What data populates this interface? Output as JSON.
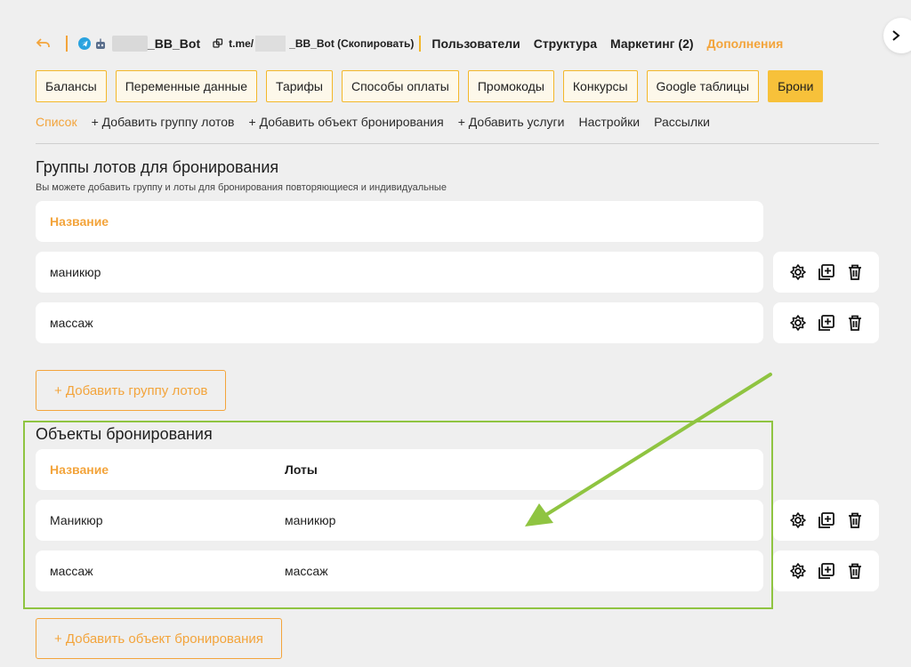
{
  "topbar": {
    "bot_name": "_BB_Bot",
    "tme_prefix": "t.me/",
    "tme_suffix": "_BB_Bot (Скопировать)",
    "nav": [
      {
        "label": "Пользователи",
        "active": false
      },
      {
        "label": "Структура",
        "active": false
      },
      {
        "label": "Маркетинг (2)",
        "active": false
      },
      {
        "label": "Дополнения",
        "active": true
      }
    ],
    "icons": {
      "back": "back-arrow-icon",
      "telegram": "telegram-icon",
      "bot": "bot-icon",
      "link": "copy-link-icon",
      "next": "chevron-right-icon"
    }
  },
  "tabs": [
    {
      "label": "Балансы",
      "active": false
    },
    {
      "label": "Переменные данные",
      "active": false
    },
    {
      "label": "Тарифы",
      "active": false
    },
    {
      "label": "Способы оплаты",
      "active": false
    },
    {
      "label": "Промокоды",
      "active": false
    },
    {
      "label": "Конкурсы",
      "active": false
    },
    {
      "label": "Google таблицы",
      "active": false
    },
    {
      "label": "Брони",
      "active": true
    }
  ],
  "subnav": [
    {
      "label": "Список",
      "active": true
    },
    {
      "label": "+ Добавить группу лотов",
      "active": false
    },
    {
      "label": "+ Добавить объект бронирования",
      "active": false
    },
    {
      "label": "+ Добавить услуги",
      "active": false
    },
    {
      "label": "Настройки",
      "active": false
    },
    {
      "label": "Рассылки",
      "active": false
    }
  ],
  "groups": {
    "title": "Группы лотов для бронирования",
    "subtitle": "Вы можете добавить группу и лоты для бронирования повторяющиеся и индивидуальные",
    "header": {
      "name": "Название"
    },
    "rows": [
      {
        "name": "маникюр"
      },
      {
        "name": "массаж"
      }
    ],
    "add_label": "+ Добавить группу лотов"
  },
  "objects": {
    "title": "Объекты бронирования",
    "header": {
      "name": "Название",
      "lots": "Лоты"
    },
    "rows": [
      {
        "name": "Маникюр",
        "lots": "маникюр"
      },
      {
        "name": "массаж",
        "lots": "массаж"
      }
    ],
    "add_label": "+ Добавить объект бронирования"
  },
  "row_actions": [
    "settings-icon",
    "duplicate-icon",
    "trash-icon"
  ],
  "colors": {
    "accent": "#f3a43b",
    "tab_active": "#f7c13a",
    "highlight": "#8fc441"
  }
}
